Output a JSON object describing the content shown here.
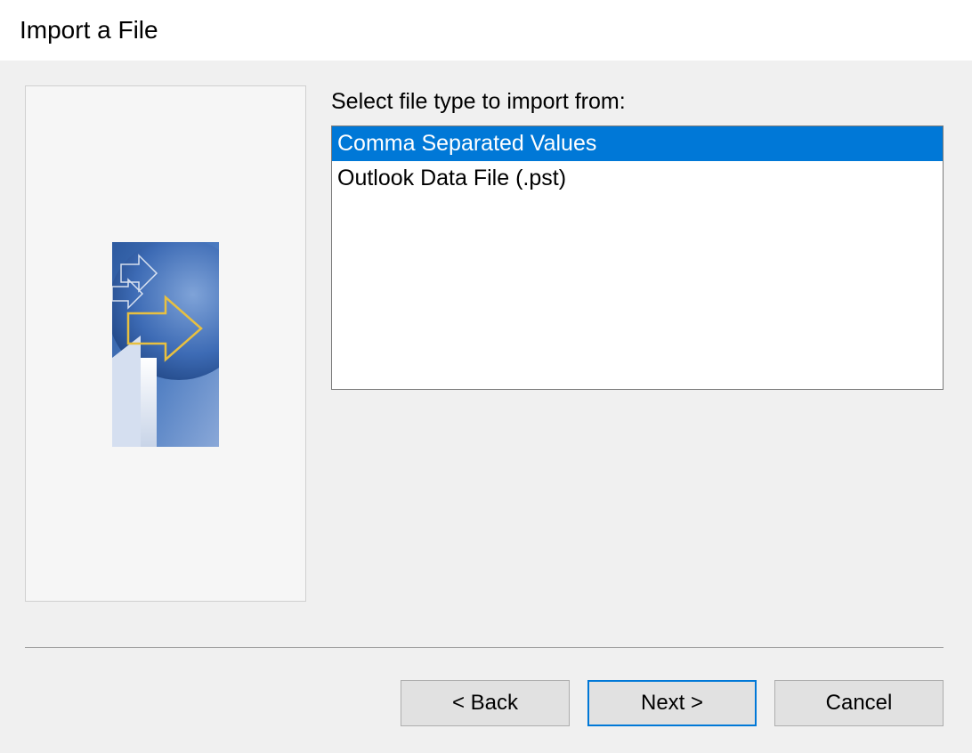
{
  "title": "Import a File",
  "instruction": "Select file type to import from:",
  "fileTypes": [
    {
      "label": "Comma Separated Values",
      "selected": true
    },
    {
      "label": "Outlook Data File (.pst)",
      "selected": false
    }
  ],
  "buttons": {
    "back": "< Back",
    "next": "Next >",
    "cancel": "Cancel"
  }
}
